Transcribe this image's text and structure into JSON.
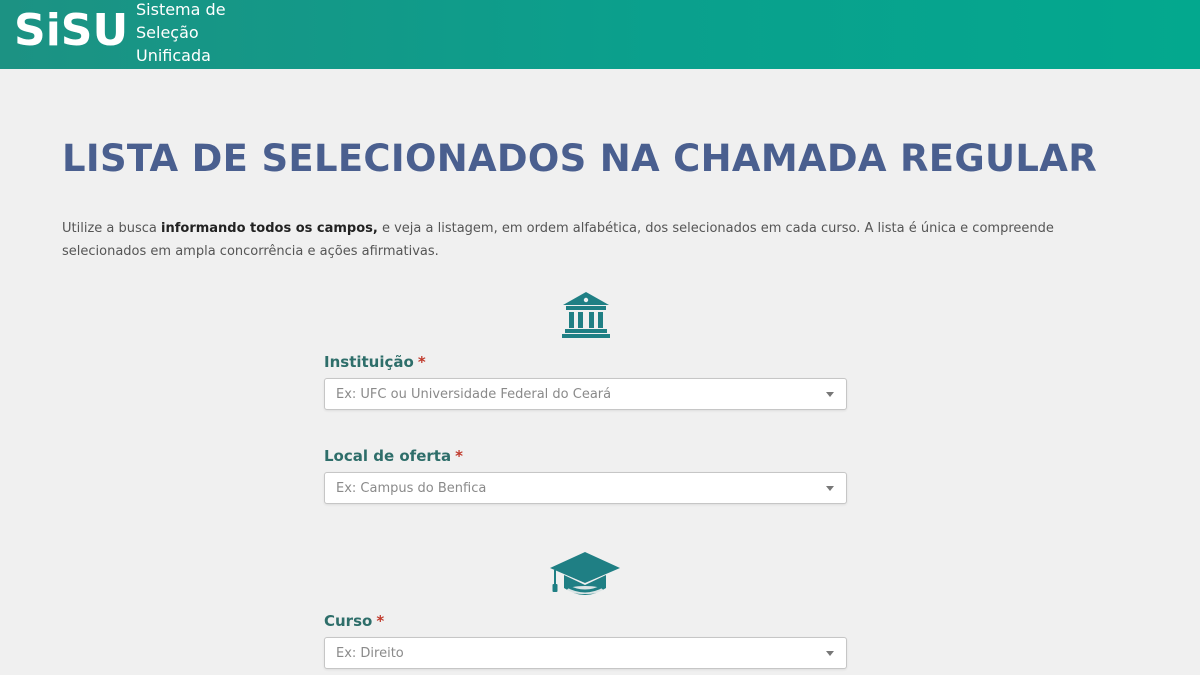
{
  "header": {
    "logo_text": "SiSU",
    "subtitle_lines": [
      "Sistema de",
      "Seleção",
      "Unificada"
    ],
    "bg_color": "#0aa08d"
  },
  "main": {
    "title": "LISTA DE SELECIONADOS NA CHAMADA REGULAR",
    "intro_prefix": "Utilize a busca ",
    "intro_bold": "informando todos os campos,",
    "intro_suffix": " e veja a listagem, em ordem alfabética, dos selecionados em cada curso. A lista é única e compreende selecionados em ampla concorrência e ações afirmativas.",
    "title_color": "#4a5f8f",
    "icon_color": "#1f7f84"
  },
  "form": {
    "sections": [
      {
        "icon": "institution-icon"
      },
      {
        "icon": "graduation-cap-icon"
      }
    ],
    "fields": [
      {
        "label": "Instituição",
        "required_mark": "*",
        "placeholder": "Ex: UFC ou Universidade Federal do Ceará"
      },
      {
        "label": "Local de oferta",
        "required_mark": "*",
        "placeholder": "Ex: Campus do Benfica"
      },
      {
        "label": "Curso",
        "required_mark": "*",
        "placeholder": "Ex: Direito"
      }
    ]
  }
}
